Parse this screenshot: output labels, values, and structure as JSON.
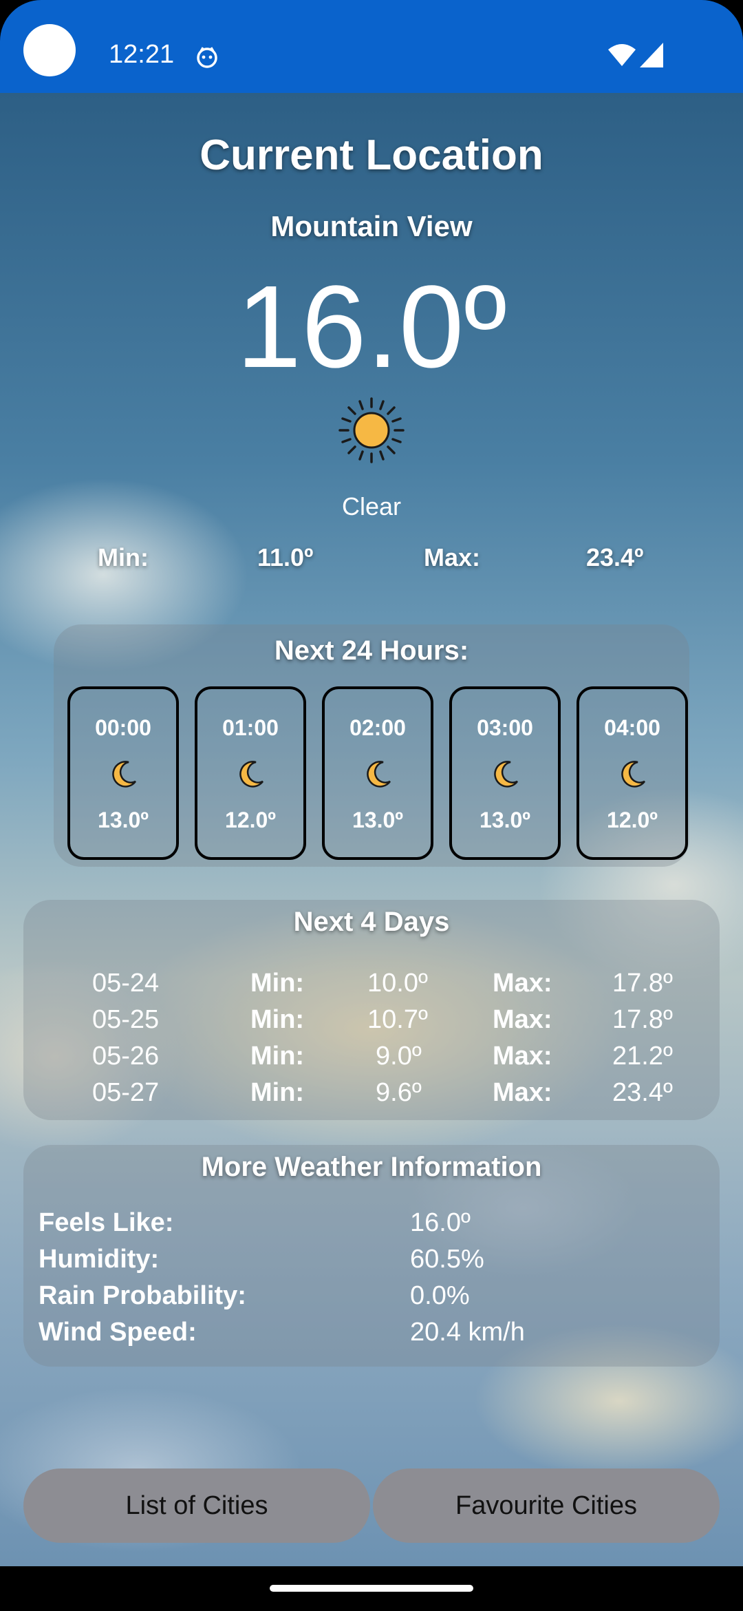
{
  "status_bar": {
    "time": "12:21",
    "icons": [
      "camera-cutout",
      "notification-icon",
      "wifi-icon",
      "signal-icon"
    ],
    "color": "#0a63cc"
  },
  "weather": {
    "title": "Current Location",
    "city": "Mountain View",
    "temperature": "16.0º",
    "condition_icon": "sun-icon",
    "condition": "Clear",
    "min_label": "Min:",
    "min_value": "11.0º",
    "max_label": "Max:",
    "max_value": "23.4º"
  },
  "hourly": {
    "title": "Next 24 Hours:",
    "items": [
      {
        "time": "00:00",
        "icon": "moon-icon",
        "temp": "13.0º"
      },
      {
        "time": "01:00",
        "icon": "moon-icon",
        "temp": "12.0º"
      },
      {
        "time": "02:00",
        "icon": "moon-icon",
        "temp": "13.0º"
      },
      {
        "time": "03:00",
        "icon": "moon-icon",
        "temp": "13.0º"
      },
      {
        "time": "04:00",
        "icon": "moon-icon",
        "temp": "12.0º"
      }
    ]
  },
  "daily": {
    "title": "Next 4 Days",
    "min_label": "Min:",
    "max_label": "Max:",
    "rows": [
      {
        "date": "05-24",
        "min": "10.0º",
        "max": "17.8º"
      },
      {
        "date": "05-25",
        "min": "10.7º",
        "max": "17.8º"
      },
      {
        "date": "05-26",
        "min": "9.0º",
        "max": "21.2º"
      },
      {
        "date": "05-27",
        "min": "9.6º",
        "max": "23.4º"
      }
    ]
  },
  "more_info": {
    "title": "More Weather Information",
    "rows": [
      {
        "label": "Feels Like:",
        "value": "16.0º"
      },
      {
        "label": "Humidity:",
        "value": "60.5%"
      },
      {
        "label": "Rain Probability:",
        "value": "0.0%"
      },
      {
        "label": "Wind Speed:",
        "value": "20.4 km/h"
      }
    ]
  },
  "buttons": {
    "list_of_cities": "List of Cities",
    "favourite_cities": "Favourite Cities"
  },
  "colors": {
    "sun": "#f6b844",
    "button": "#8d8d93"
  }
}
